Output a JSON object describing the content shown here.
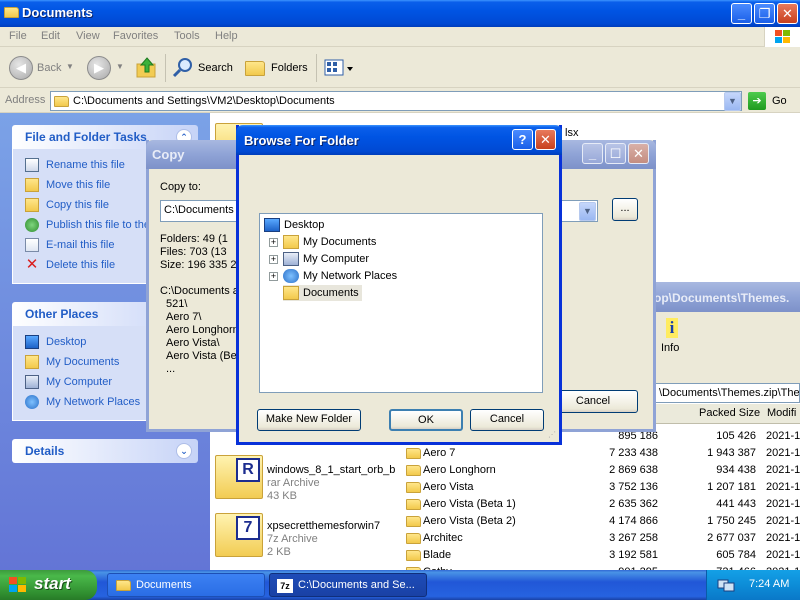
{
  "explorer": {
    "title": "Documents",
    "menu": [
      "File",
      "Edit",
      "View",
      "Favorites",
      "Tools",
      "Help"
    ],
    "toolbar": {
      "back": "Back",
      "search": "Search",
      "folders": "Folders"
    },
    "address_label": "Address",
    "address": "C:\\Documents and Settings\\VM2\\Desktop\\Documents",
    "go": "Go",
    "partial_filename": "lsx"
  },
  "taskpane": {
    "file_tasks": {
      "title": "File and Folder Tasks",
      "items": [
        {
          "label": "Rename this file",
          "icon": "rename-icon"
        },
        {
          "label": "Move this file",
          "icon": "move-icon"
        },
        {
          "label": "Copy this file",
          "icon": "copy-icon"
        },
        {
          "label": "Publish this file to the Web",
          "icon": "globe-icon"
        },
        {
          "label": "E-mail this file",
          "icon": "email-icon"
        },
        {
          "label": "Delete this file",
          "icon": "delete-icon"
        }
      ]
    },
    "other_places": {
      "title": "Other Places",
      "items": [
        {
          "label": "Desktop",
          "icon": "desktop-icon"
        },
        {
          "label": "My Documents",
          "icon": "my-documents-icon"
        },
        {
          "label": "My Computer",
          "icon": "my-computer-icon"
        },
        {
          "label": "My Network Places",
          "icon": "network-places-icon"
        }
      ]
    },
    "details": {
      "title": "Details"
    }
  },
  "files": [
    {
      "name": "windows_8_1_start_orb_b",
      "type": "rar Archive",
      "size": "43 KB",
      "badge": "R"
    },
    {
      "name": "xpsecretthemesforwin7",
      "type": "7z Archive",
      "size": "2 KB",
      "badge": "7"
    }
  ],
  "copy_dialog": {
    "title": "Copy",
    "copy_to_label": "Copy to:",
    "copy_to_value": "C:\\Documents a",
    "browse_btn": "...",
    "stats": [
      "Folders: 49   (1",
      "Files: 703   (13",
      "Size: 196 335 28"
    ],
    "list": [
      "C:\\Documents a",
      "521\\",
      "Aero 7\\",
      "Aero Longhorn",
      "Aero Vista\\",
      "Aero Vista (Bet",
      "..."
    ],
    "cancel": "Cancel"
  },
  "zip_window": {
    "title": "op\\Documents\\Themes.",
    "info": "Info",
    "address": "\\Documents\\Themes.zip\\Theme",
    "headers": {
      "packed": "Packed Size",
      "modified": "Modifi"
    },
    "rows": [
      {
        "name": "",
        "size": "895 186",
        "packed": "105 426",
        "modified": "2021-1"
      },
      {
        "name": "Aero 7",
        "size": "7 233 438",
        "packed": "1 943 387",
        "modified": "2021-1"
      },
      {
        "name": "Aero Longhorn",
        "size": "2 869 638",
        "packed": "934 438",
        "modified": "2021-1"
      },
      {
        "name": "Aero Vista",
        "size": "3 752 136",
        "packed": "1 207 181",
        "modified": "2021-1"
      },
      {
        "name": "Aero Vista (Beta 1)",
        "size": "2 635 362",
        "packed": "441 443",
        "modified": "2021-1"
      },
      {
        "name": "Aero Vista (Beta 2)",
        "size": "4 174 866",
        "packed": "1 750 245",
        "modified": "2021-1"
      },
      {
        "name": "Architec",
        "size": "3 267 258",
        "packed": "2 677 037",
        "modified": "2021-1"
      },
      {
        "name": "Blade",
        "size": "3 192 581",
        "packed": "605 784",
        "modified": "2021-1"
      },
      {
        "name": "Cathy",
        "size": "901 295",
        "packed": "721 466",
        "modified": "2021-1"
      }
    ]
  },
  "browse_dialog": {
    "title": "Browse For Folder",
    "help": "?",
    "close": "✕",
    "tree": [
      {
        "label": "Desktop",
        "icon": "desktop-icon"
      },
      {
        "label": "My Documents",
        "icon": "my-documents-icon"
      },
      {
        "label": "My Computer",
        "icon": "my-computer-icon"
      },
      {
        "label": "My Network Places",
        "icon": "network-places-icon"
      },
      {
        "label": "Documents",
        "icon": "folder-icon",
        "selected": true
      }
    ],
    "make_new_folder": "Make New Folder",
    "ok": "OK",
    "cancel": "Cancel"
  },
  "taskbar": {
    "start": "start",
    "tasks": [
      "Documents",
      "C:\\Documents and Se..."
    ],
    "clock": "7:24 AM"
  }
}
